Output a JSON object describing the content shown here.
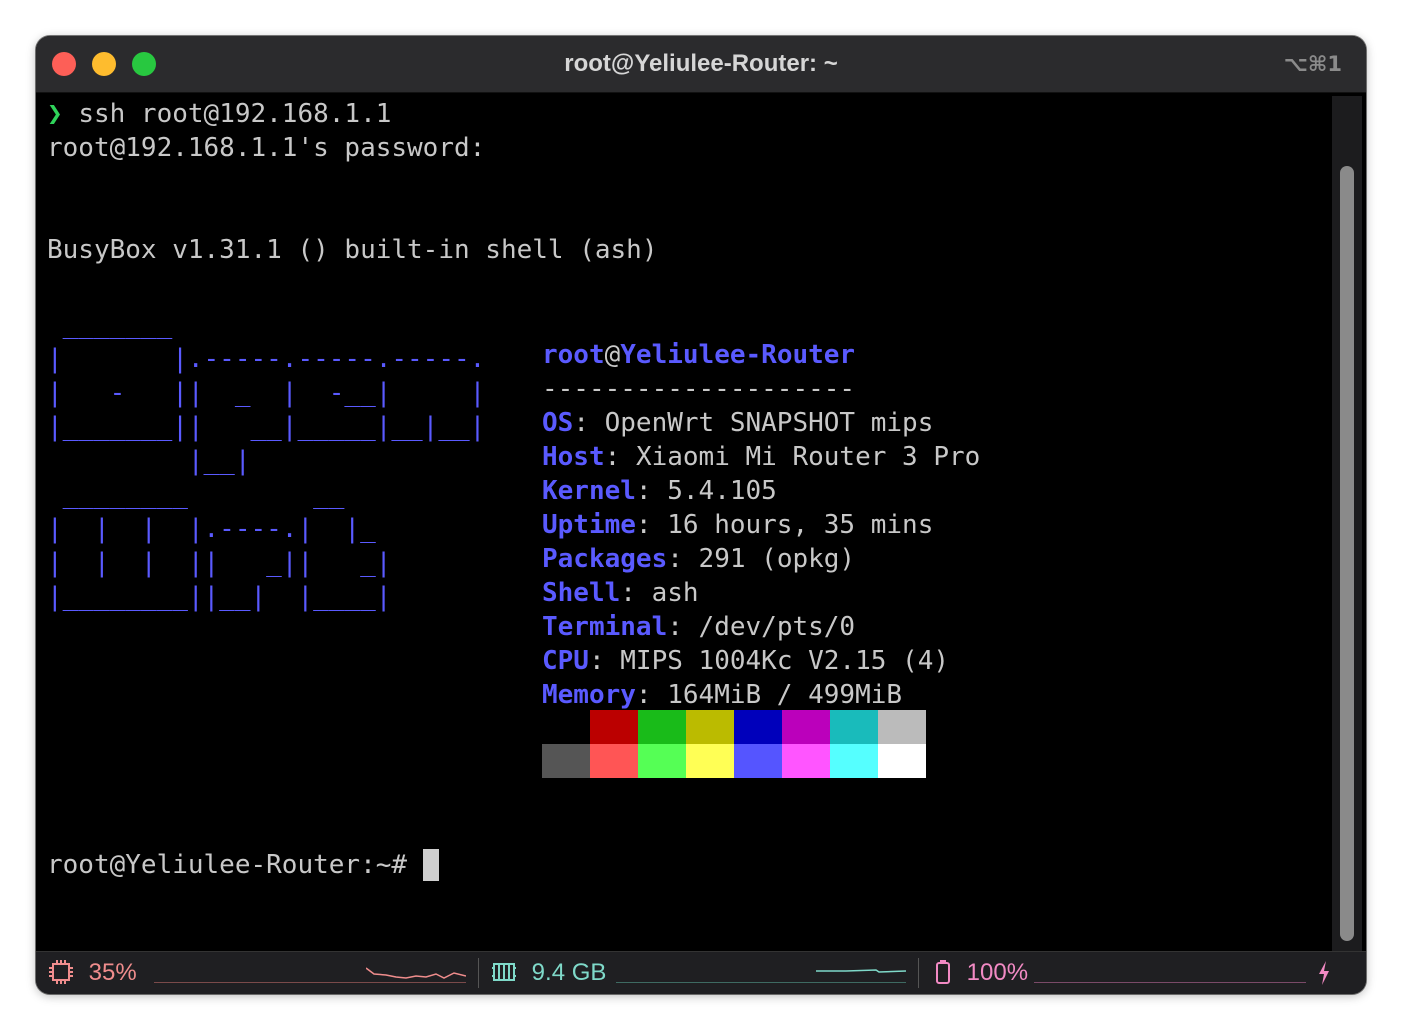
{
  "window": {
    "title": "root@Yeliulee-Router: ~",
    "shortcut": "⌥⌘1"
  },
  "terminal": {
    "prompt_symbol": "❯",
    "command": "ssh root@192.168.1.1",
    "password_prompt": "root@192.168.1.1's password:",
    "busybox_banner": "BusyBox v1.31.1 () built-in shell (ash)",
    "logo_art": " _______\n|       |.-----.-----.-----.\n|   -   ||  _  |  -__|     |\n|_______||   __|_____|__|__|\n         |__|\n ________        __\n|  |  |  |.----.|  |_\n|  |  |  ||   _||   _|\n|________||__|  |____|",
    "neofetch": {
      "user": "root",
      "at": "@",
      "host": "Yeliulee-Router",
      "underline": "--------------------",
      "fields": [
        {
          "key": "OS",
          "value": "OpenWrt SNAPSHOT mips"
        },
        {
          "key": "Host",
          "value": "Xiaomi Mi Router 3 Pro"
        },
        {
          "key": "Kernel",
          "value": "5.4.105"
        },
        {
          "key": "Uptime",
          "value": "16 hours, 35 mins"
        },
        {
          "key": "Packages",
          "value": "291 (opkg)"
        },
        {
          "key": "Shell",
          "value": "ash"
        },
        {
          "key": "Terminal",
          "value": "/dev/pts/0"
        },
        {
          "key": "CPU",
          "value": "MIPS 1004Kc V2.15 (4)"
        },
        {
          "key": "Memory",
          "value": "164MiB / 499MiB"
        }
      ],
      "palette_top": [
        "#000000",
        "#bb0000",
        "#19bb19",
        "#bbbb00",
        "#0000bb",
        "#bb00bb",
        "#19bbbb",
        "#bbbbbb"
      ],
      "palette_bottom": [
        "#555555",
        "#ff5555",
        "#55ff55",
        "#ffff55",
        "#5555ff",
        "#ff55ff",
        "#55ffff",
        "#ffffff"
      ]
    },
    "final_prompt": "root@Yeliulee-Router:~#"
  },
  "status": {
    "cpu_icon": "cpu-icon",
    "cpu": "35%",
    "cpu_color": "#f08d8d",
    "memory_icon": "memory-icon",
    "memory": "9.4 GB",
    "memory_color": "#7fd9c9",
    "battery_icon": "battery-icon",
    "battery": "100%",
    "battery_color": "#f28ac4",
    "charging_icon": "bolt-icon"
  }
}
